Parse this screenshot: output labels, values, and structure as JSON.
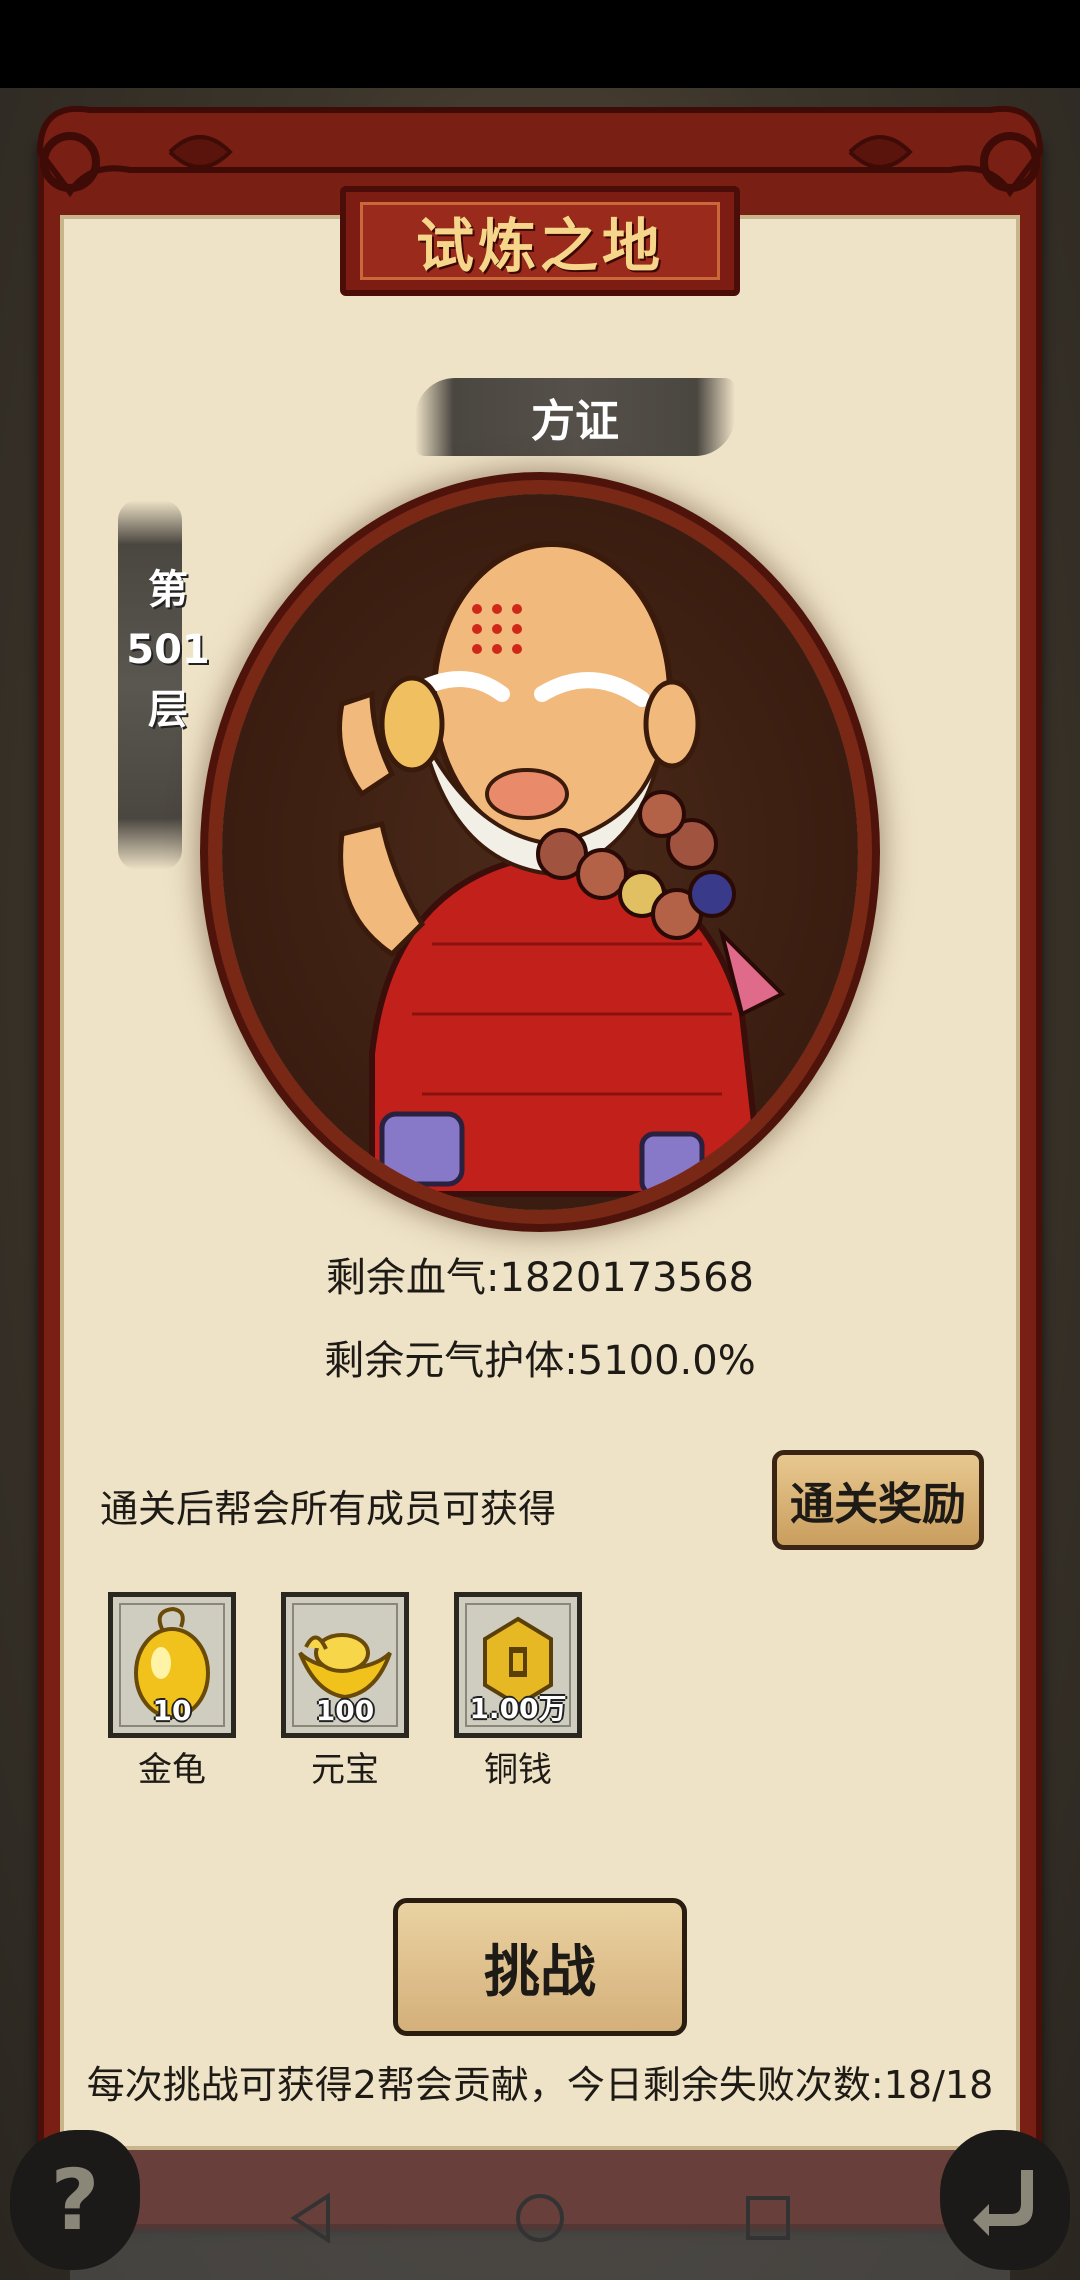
{
  "title": "试炼之地",
  "boss": {
    "name": "方证",
    "floor_prefix": "第",
    "floor_number": "501",
    "floor_suffix": "层"
  },
  "stats": {
    "hp": "剩余血气:1820173568",
    "shield": "剩余元气护体:5100.0%"
  },
  "rewards": {
    "caption": "通关后帮会所有成员可获得",
    "button_label": "通关奖励",
    "items": [
      {
        "label": "金龟",
        "count": "10",
        "icon": "golden-turtle-egg-icon"
      },
      {
        "label": "元宝",
        "count": "100",
        "icon": "gold-ingot-icon"
      },
      {
        "label": "铜钱",
        "count": "1.00万",
        "icon": "copper-coin-icon"
      }
    ]
  },
  "challenge": {
    "button_label": "挑战",
    "note": "每次挑战可获得2帮会贡献，今日剩余失败次数:18/18"
  },
  "corner_buttons": {
    "help_label": "?",
    "help_icon": "help-icon",
    "back_icon": "return-arrow-icon"
  },
  "system_nav": [
    "back-triangle-icon",
    "home-circle-icon",
    "recents-square-icon"
  ],
  "colors": {
    "frame": "#7a1f14",
    "panel": "#efe3c7",
    "title_text": "#f6d68a",
    "button_fill": "#d4b07a"
  }
}
